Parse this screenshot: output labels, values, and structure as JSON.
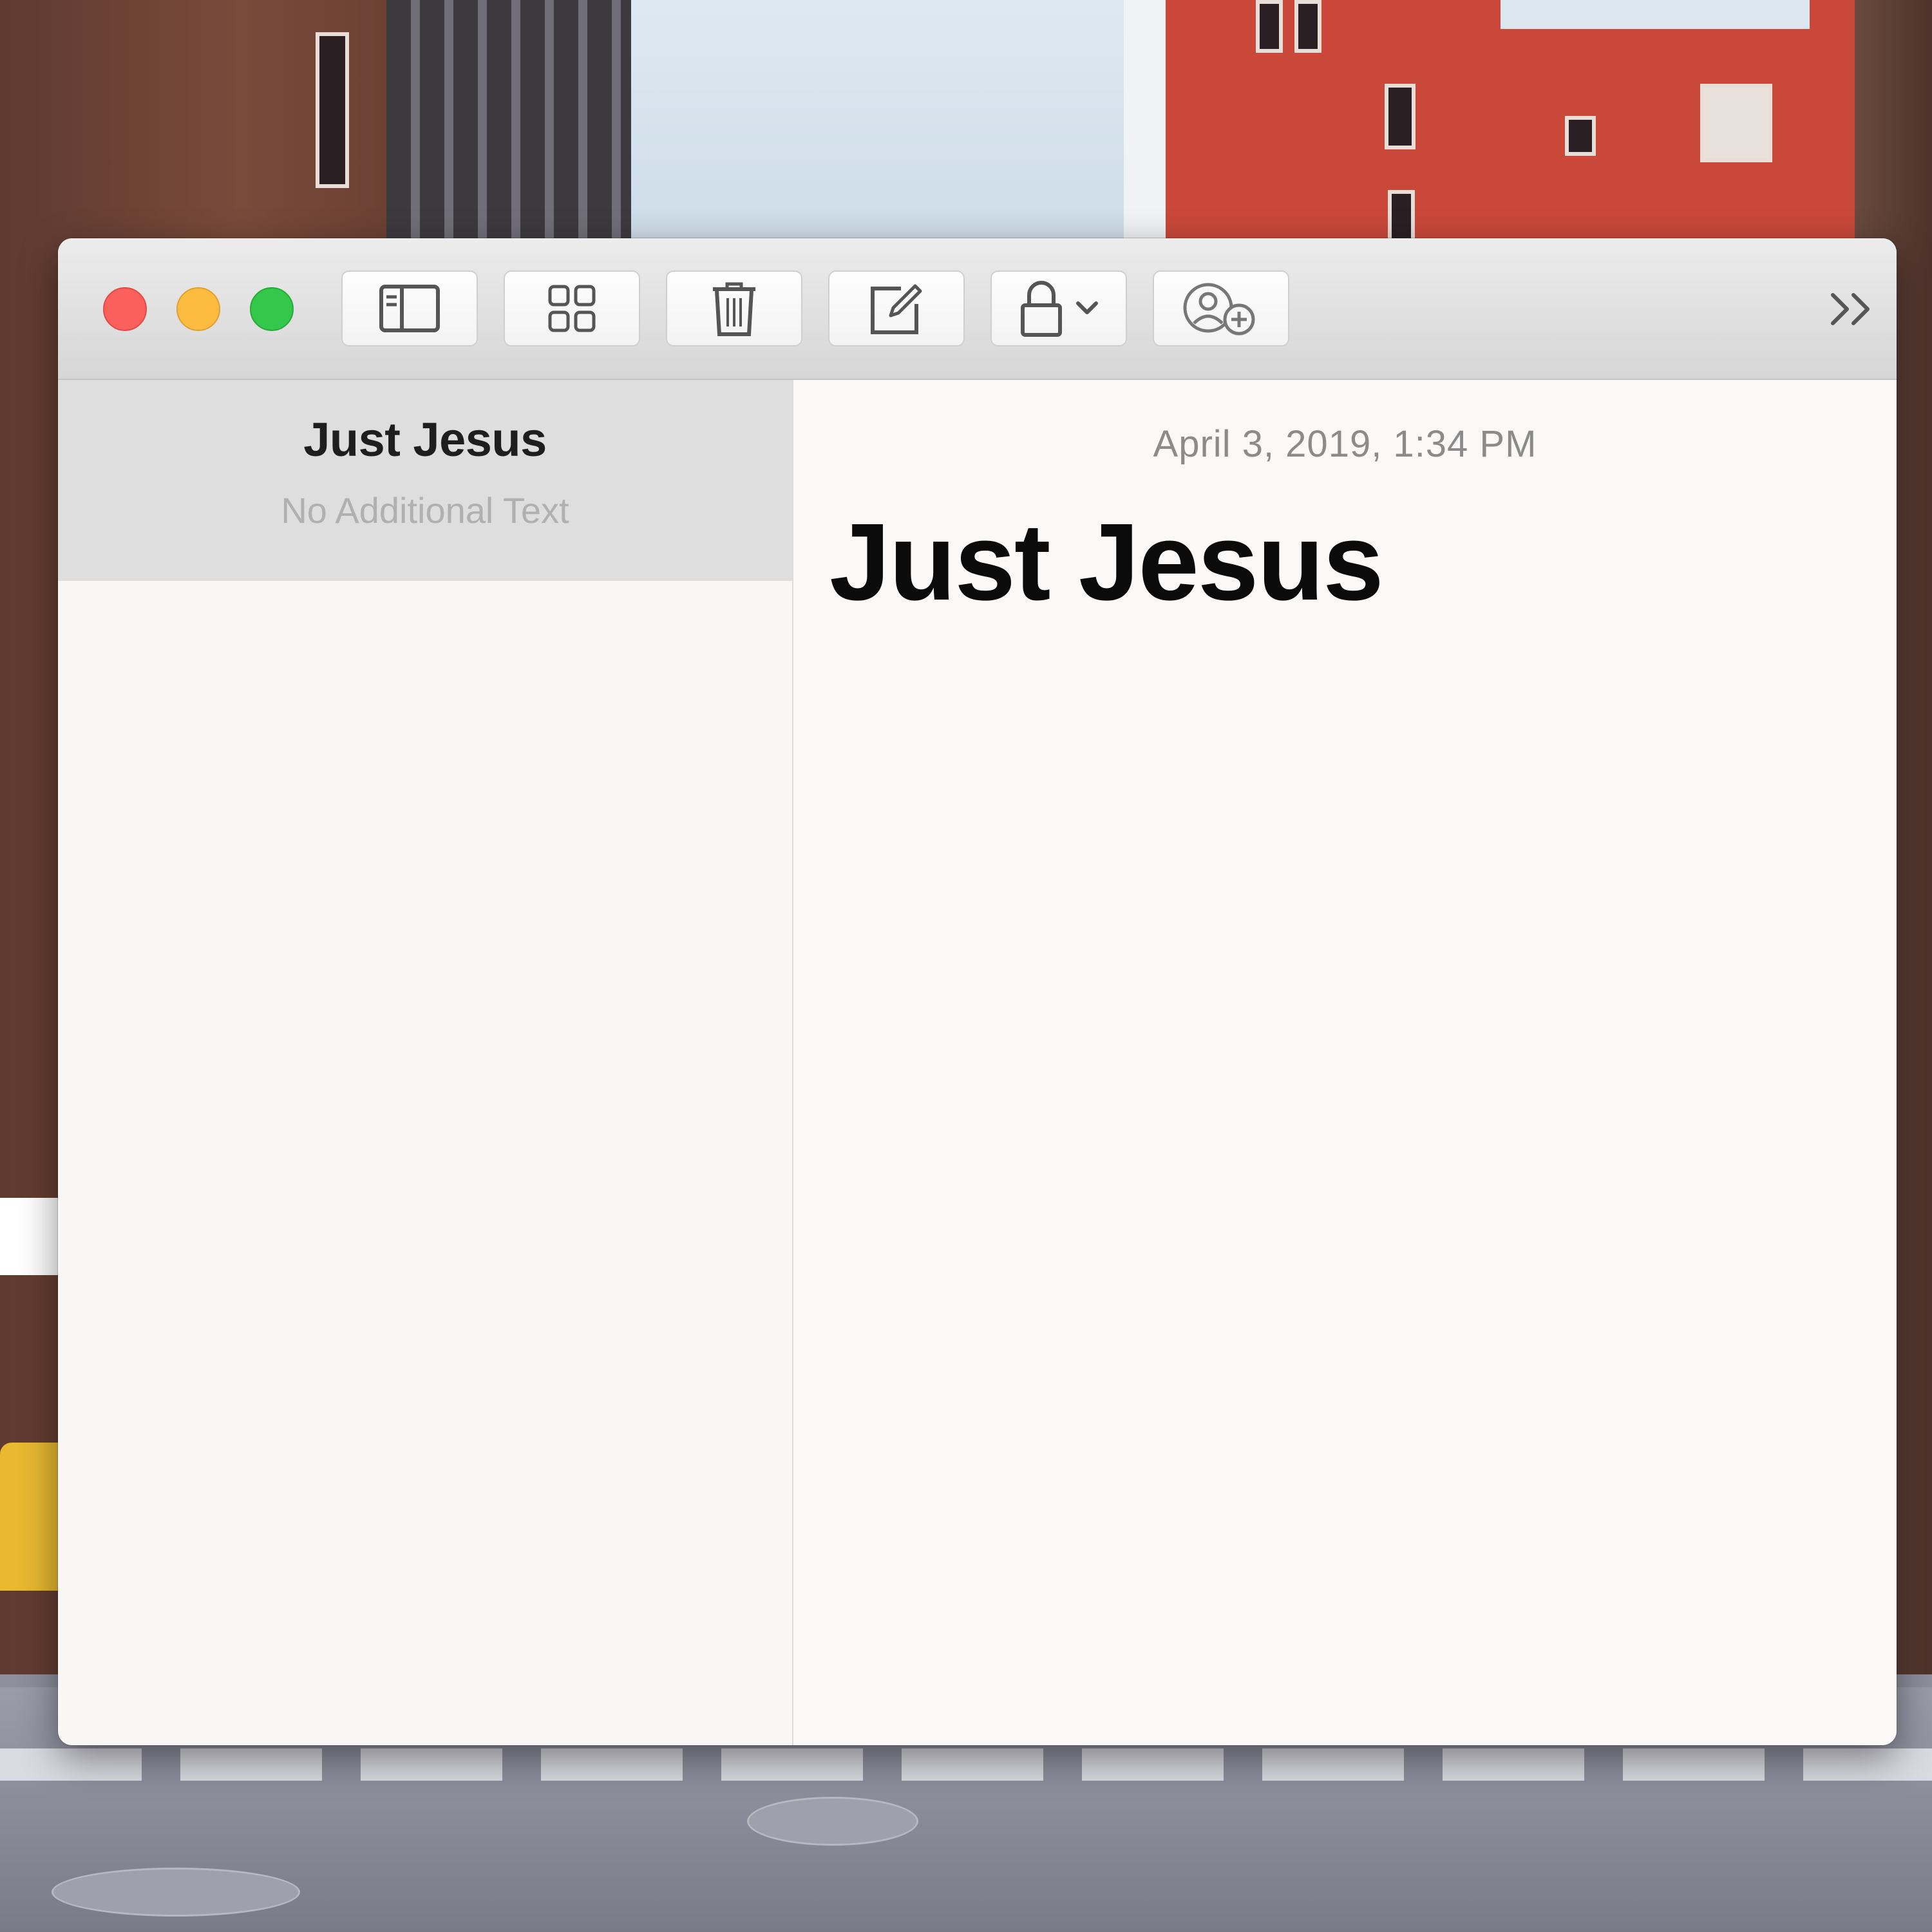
{
  "window": {
    "controls": {
      "close": {
        "color": "#fc605c"
      },
      "minimize": {
        "color": "#fdbc40"
      },
      "zoom": {
        "color": "#34c84a"
      }
    }
  },
  "toolbar": {
    "buttons": [
      {
        "name": "toggle-sidebar-button",
        "icon": "sidebar-icon"
      },
      {
        "name": "gallery-view-button",
        "icon": "grid-icon"
      },
      {
        "name": "delete-note-button",
        "icon": "trash-icon"
      },
      {
        "name": "new-note-button",
        "icon": "compose-icon"
      },
      {
        "name": "lock-note-button",
        "icon": "lock-icon",
        "has_dropdown": true
      },
      {
        "name": "add-people-button",
        "icon": "add-person-icon"
      }
    ],
    "overflow_icon": "chevron-double-right-icon"
  },
  "notes_list": {
    "items": [
      {
        "title": "Just Jesus",
        "subtitle": "No Additional Text",
        "selected": true
      }
    ],
    "selected_background": "#dedede"
  },
  "editor": {
    "date": "April 3, 2019, 1:34 PM",
    "title": "Just Jesus"
  }
}
